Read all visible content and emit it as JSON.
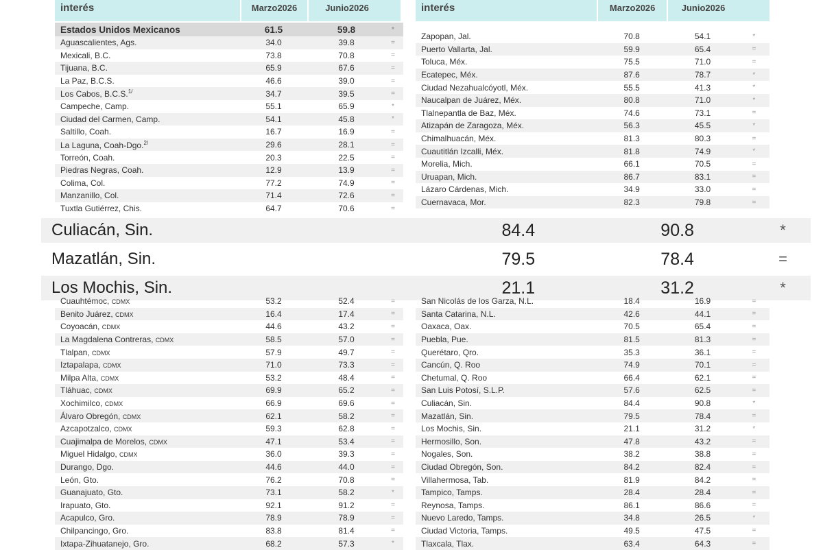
{
  "header": {
    "city_label": "interés",
    "col1": [
      "Marzo",
      "2026"
    ],
    "col2": [
      "Junio",
      "2026"
    ]
  },
  "left": [
    {
      "city": "Estados Unidos Mexicanos",
      "m": "61.5",
      "j": "59.8",
      "mark": "*",
      "total": true
    },
    {
      "city": "Aguascalientes, Ags.",
      "m": "34.0",
      "j": "39.8",
      "mark": "="
    },
    {
      "city": "Mexicali, B.C.",
      "m": "73.8",
      "j": "70.8",
      "mark": "="
    },
    {
      "city": "Tijuana, B.C.",
      "m": "65.9",
      "j": "67.6",
      "mark": "="
    },
    {
      "city": "La Paz, B.C.S.",
      "m": "46.6",
      "j": "39.0",
      "mark": "="
    },
    {
      "city": "Los Cabos, B.C.S.",
      "sup": "1/",
      "m": "34.7",
      "j": "39.5",
      "mark": "="
    },
    {
      "city": "Campeche, Camp.",
      "m": "55.1",
      "j": "65.9",
      "mark": "*"
    },
    {
      "city": "Ciudad del Carmen, Camp.",
      "m": "54.1",
      "j": "45.8",
      "mark": "*"
    },
    {
      "city": "Saltillo, Coah.",
      "m": "16.7",
      "j": "16.9",
      "mark": "="
    },
    {
      "city": "La Laguna, Coah-Dgo.",
      "sup": "2/",
      "m": "29.6",
      "j": "28.1",
      "mark": "="
    },
    {
      "city": "Torreón, Coah.",
      "m": "20.3",
      "j": "22.5",
      "mark": "="
    },
    {
      "city": "Piedras Negras, Coah.",
      "m": "12.9",
      "j": "13.9",
      "mark": "="
    },
    {
      "city": "Colima, Col.",
      "m": "77.2",
      "j": "74.9",
      "mark": "="
    },
    {
      "city": "Manzanillo, Col.",
      "m": "71.4",
      "j": "72.6",
      "mark": "="
    },
    {
      "city": "Tuxtla Gutiérrez, Chis.",
      "m": "64.7",
      "j": "70.6",
      "mark": "="
    }
  ],
  "right": [
    {
      "city": "Zapopan, Jal.",
      "m": "70.8",
      "j": "54.1",
      "mark": "*"
    },
    {
      "city": "Puerto Vallarta, Jal.",
      "m": "59.9",
      "j": "65.4",
      "mark": "="
    },
    {
      "city": "Toluca, Méx.",
      "m": "75.5",
      "j": "71.0",
      "mark": "="
    },
    {
      "city": "Ecatepec, Méx.",
      "m": "87.6",
      "j": "78.7",
      "mark": "*"
    },
    {
      "city": "Ciudad Nezahualcóyotl, Méx.",
      "m": "55.5",
      "j": "41.3",
      "mark": "*"
    },
    {
      "city": "Naucalpan de Juárez, Méx.",
      "m": "80.8",
      "j": "71.0",
      "mark": "*"
    },
    {
      "city": "Tlalnepantla de Baz, Méx.",
      "m": "74.6",
      "j": "73.1",
      "mark": "="
    },
    {
      "city": "Atizapán de Zaragoza, Méx.",
      "m": "56.3",
      "j": "45.5",
      "mark": "*"
    },
    {
      "city": "Chimalhuacán, Méx.",
      "m": "81.3",
      "j": "80.3",
      "mark": "="
    },
    {
      "city": "Cuautitlán Izcalli, Méx.",
      "m": "81.8",
      "j": "74.9",
      "mark": "*"
    },
    {
      "city": "Morelia, Mich.",
      "m": "66.1",
      "j": "70.5",
      "mark": "="
    },
    {
      "city": "Uruapan, Mich.",
      "m": "86.7",
      "j": "83.1",
      "mark": "="
    },
    {
      "city": "Lázaro Cárdenas, Mich.",
      "m": "34.9",
      "j": "33.0",
      "mark": "="
    },
    {
      "city": "Cuernavaca, Mor.",
      "m": "82.3",
      "j": "79.8",
      "mark": "="
    }
  ],
  "highlight": [
    {
      "city": "Culiacán, Sin.",
      "m": "84.4",
      "j": "90.8",
      "mark": "*"
    },
    {
      "city": "Mazatlán, Sin.",
      "m": "79.5",
      "j": "78.4",
      "mark": "="
    },
    {
      "city": "Los Mochis, Sin.",
      "m": "21.1",
      "j": "31.2",
      "mark": "*"
    }
  ],
  "left_bottom": [
    {
      "city": "Cuauhtémoc, CDMX",
      "m": "53.2",
      "j": "52.4",
      "mark": "="
    },
    {
      "city": "Benito Juárez, CDMX",
      "m": "16.4",
      "j": "17.4",
      "mark": "="
    },
    {
      "city": "Coyoacán, CDMX",
      "m": "44.6",
      "j": "43.2",
      "mark": "="
    },
    {
      "city": "La Magdalena Contreras, CDMX",
      "m": "58.5",
      "j": "57.0",
      "mark": "="
    },
    {
      "city": "Tlalpan, CDMX",
      "m": "57.9",
      "j": "49.7",
      "mark": "="
    },
    {
      "city": "Iztapalapa, CDMX",
      "m": "71.0",
      "j": "73.3",
      "mark": "="
    },
    {
      "city": "Milpa Alta, CDMX",
      "m": "53.2",
      "j": "48.4",
      "mark": "="
    },
    {
      "city": "Tláhuac, CDMX",
      "m": "69.9",
      "j": "65.2",
      "mark": "="
    },
    {
      "city": "Xochimilco, CDMX",
      "m": "66.9",
      "j": "69.6",
      "mark": "="
    },
    {
      "city": "Álvaro Obregón, CDMX",
      "m": "62.1",
      "j": "58.2",
      "mark": "="
    },
    {
      "city": "Azcapotzalco, CDMX",
      "m": "59.3",
      "j": "62.8",
      "mark": "="
    },
    {
      "city": "Cuajimalpa de Morelos, CDMX",
      "m": "47.1",
      "j": "53.4",
      "mark": "="
    },
    {
      "city": "Miguel Hidalgo, CDMX",
      "m": "36.0",
      "j": "39.3",
      "mark": "="
    },
    {
      "city": "Durango, Dgo.",
      "m": "44.6",
      "j": "44.0",
      "mark": "="
    },
    {
      "city": "León, Gto.",
      "m": "76.2",
      "j": "70.8",
      "mark": "="
    },
    {
      "city": "Guanajuato, Gto.",
      "m": "73.1",
      "j": "58.2",
      "mark": "*"
    },
    {
      "city": "Irapuato, Gto.",
      "m": "92.1",
      "j": "91.2",
      "mark": "="
    },
    {
      "city": "Acapulco, Gro.",
      "m": "78.9",
      "j": "78.9",
      "mark": "="
    },
    {
      "city": "Chilpancingo, Gro.",
      "m": "83.8",
      "j": "81.4",
      "mark": "="
    },
    {
      "city": "Ixtapa-Zihuatanejo, Gro.",
      "m": "68.2",
      "j": "57.3",
      "mark": "*"
    }
  ],
  "right_bottom": [
    {
      "city": "San Nicolás de los Garza, N.L.",
      "m": "18.4",
      "j": "16.9",
      "mark": "="
    },
    {
      "city": "Santa Catarina, N.L.",
      "m": "42.6",
      "j": "44.1",
      "mark": "="
    },
    {
      "city": "Oaxaca, Oax.",
      "m": "70.5",
      "j": "65.4",
      "mark": "="
    },
    {
      "city": "Puebla, Pue.",
      "m": "81.5",
      "j": "81.3",
      "mark": "="
    },
    {
      "city": "Querétaro, Qro.",
      "m": "35.3",
      "j": "36.1",
      "mark": "="
    },
    {
      "city": "Cancún, Q. Roo",
      "m": "74.9",
      "j": "70.1",
      "mark": "="
    },
    {
      "city": "Chetumal, Q. Roo",
      "m": "66.4",
      "j": "62.1",
      "mark": "="
    },
    {
      "city": "San Luis Potosí, S.L.P.",
      "m": "57.6",
      "j": "62.5",
      "mark": "="
    },
    {
      "city": "Culiacán, Sin.",
      "m": "84.4",
      "j": "90.8",
      "mark": "*"
    },
    {
      "city": "Mazatlán, Sin.",
      "m": "79.5",
      "j": "78.4",
      "mark": "="
    },
    {
      "city": "Los Mochis, Sin.",
      "m": "21.1",
      "j": "31.2",
      "mark": "*"
    },
    {
      "city": "Hermosillo, Son.",
      "m": "47.8",
      "j": "43.2",
      "mark": "="
    },
    {
      "city": "Nogales, Son.",
      "m": "38.2",
      "j": "38.8",
      "mark": "="
    },
    {
      "city": "Ciudad Obregón, Son.",
      "m": "84.2",
      "j": "82.4",
      "mark": "="
    },
    {
      "city": "Villahermosa, Tab.",
      "m": "81.9",
      "j": "84.2",
      "mark": "="
    },
    {
      "city": "Tampico, Tamps.",
      "m": "28.4",
      "j": "28.4",
      "mark": "="
    },
    {
      "city": "Reynosa, Tamps.",
      "m": "86.1",
      "j": "86.6",
      "mark": "="
    },
    {
      "city": "Nuevo Laredo, Tamps.",
      "m": "34.8",
      "j": "26.5",
      "mark": "*"
    },
    {
      "city": "Ciudad Victoria, Tamps.",
      "m": "49.5",
      "j": "47.5",
      "mark": "="
    },
    {
      "city": "Tlaxcala, Tlax.",
      "m": "63.4",
      "j": "64.3",
      "mark": "="
    }
  ]
}
